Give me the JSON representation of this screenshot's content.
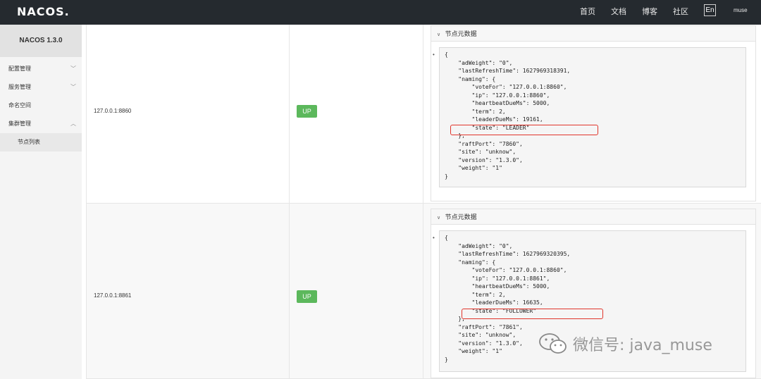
{
  "header": {
    "logo": "NACOS.",
    "nav": [
      "首页",
      "文档",
      "博客",
      "社区"
    ],
    "lang": "En",
    "user": "muse"
  },
  "sidebar": {
    "title": "NACOS 1.3.0",
    "items": [
      "配置管理",
      "服务管理",
      "命名空间",
      "集群管理"
    ],
    "sub_item": "节点列表"
  },
  "nodes": [
    {
      "address": "127.0.0.1:8860",
      "state": "UP",
      "meta_title": "节点元数据",
      "json": [
        "{",
        "    \"adWeight\": \"0\",",
        "    \"lastRefreshTime\": 1627969318391,",
        "    \"naming\": {",
        "        \"voteFor\": \"127.0.0.1:8860\",",
        "        \"ip\": \"127.0.0.1:8860\",",
        "        \"heartbeatDueMs\": 5000,",
        "        \"term\": 2,",
        "        \"leaderDueMs\": 19161,",
        "        \"state\": \"LEADER\"",
        "    },",
        "    \"raftPort\": \"7860\",",
        "    \"site\": \"unknow\",",
        "    \"version\": \"1.3.0\",",
        "    \"weight\": \"1\"",
        "}"
      ]
    },
    {
      "address": "127.0.0.1:8861",
      "state": "UP",
      "meta_title": "节点元数据",
      "json": [
        "{",
        "    \"adWeight\": \"0\",",
        "    \"lastRefreshTime\": 1627969320395,",
        "    \"naming\": {",
        "        \"voteFor\": \"127.0.0.1:8860\",",
        "        \"ip\": \"127.0.0.1:8861\",",
        "        \"heartbeatDueMs\": 5000,",
        "        \"term\": 2,",
        "        \"leaderDueMs\": 16635,",
        "        \"state\": \"FOLLOWER\"",
        "    },",
        "    \"raftPort\": \"7861\",",
        "    \"site\": \"unknow\",",
        "    \"version\": \"1.3.0\",",
        "    \"weight\": \"1\"",
        "}"
      ]
    }
  ],
  "watermark": "微信号: java_muse",
  "colors": {
    "topbar": "#252a2f",
    "up_badge": "#5cb85c",
    "highlight": "#e0352b"
  }
}
